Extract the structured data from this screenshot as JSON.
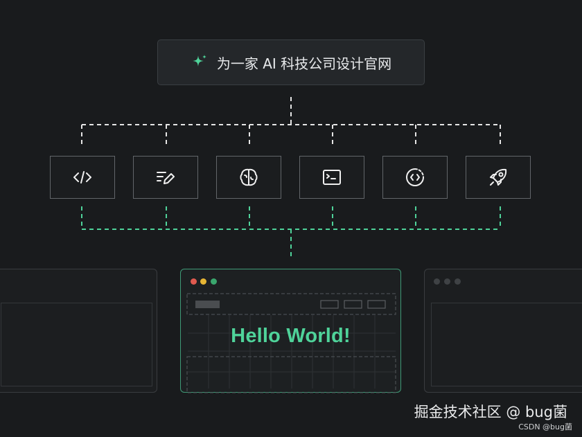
{
  "prompt": {
    "text": "为一家 AI 科技公司设计官网",
    "icon": "sparkle-icon"
  },
  "tools": [
    {
      "icon": "code-icon"
    },
    {
      "icon": "edit-list-icon"
    },
    {
      "icon": "brain-icon"
    },
    {
      "icon": "terminal-icon"
    },
    {
      "icon": "code-cycle-icon"
    },
    {
      "icon": "rocket-icon"
    }
  ],
  "preview": {
    "headline": "Hello World!"
  },
  "colors": {
    "accent": "#4fd39a",
    "connector_white": "#e6e6e6",
    "connector_green": "#4fd39a"
  },
  "watermark": {
    "text": "掘金技术社区 @ bug菌",
    "credit": "CSDN @bug菌"
  }
}
